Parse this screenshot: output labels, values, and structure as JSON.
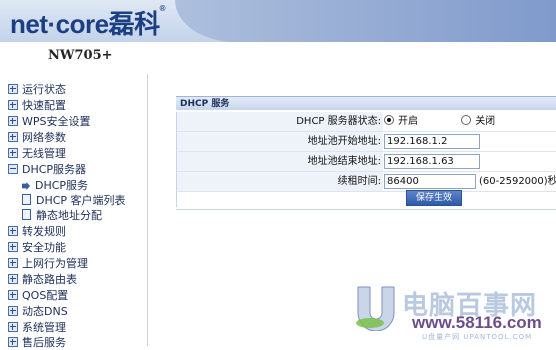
{
  "brand": {
    "logo_text": "net·core",
    "logo_cn": "磊科",
    "registered": "®"
  },
  "model": "NW705+",
  "sidebar": {
    "items": [
      {
        "label": "运行状态"
      },
      {
        "label": "快速配置"
      },
      {
        "label": "WPS安全设置"
      },
      {
        "label": "网络参数"
      },
      {
        "label": "无线管理"
      },
      {
        "label": "DHCP服务器"
      },
      {
        "label": "DHCP服务"
      },
      {
        "label": "DHCP 客户端列表"
      },
      {
        "label": "静态地址分配"
      },
      {
        "label": "转发规则"
      },
      {
        "label": "安全功能"
      },
      {
        "label": "上网行为管理"
      },
      {
        "label": "静态路由表"
      },
      {
        "label": "QOS配置"
      },
      {
        "label": "动态DNS"
      },
      {
        "label": "系统管理"
      },
      {
        "label": "售后服务"
      }
    ]
  },
  "panel": {
    "title": "DHCP 服务",
    "status_label": "DHCP 服务器状态:",
    "status_on": "开启",
    "status_off": "关闭",
    "status_selected": "on",
    "start_label": "地址池开始地址:",
    "start_value": "192.168.1.2",
    "end_label": "地址池结束地址:",
    "end_value": "192.168.1.63",
    "lease_label": "续租时间:",
    "lease_value": "86400",
    "lease_hint": "(60-2592000)秒",
    "save_label": "保存生效"
  },
  "watermark": {
    "brand": "电脑百事网",
    "url": "www.58116.com",
    "sub": "U盘量产网 UPANTOOL.COM"
  }
}
